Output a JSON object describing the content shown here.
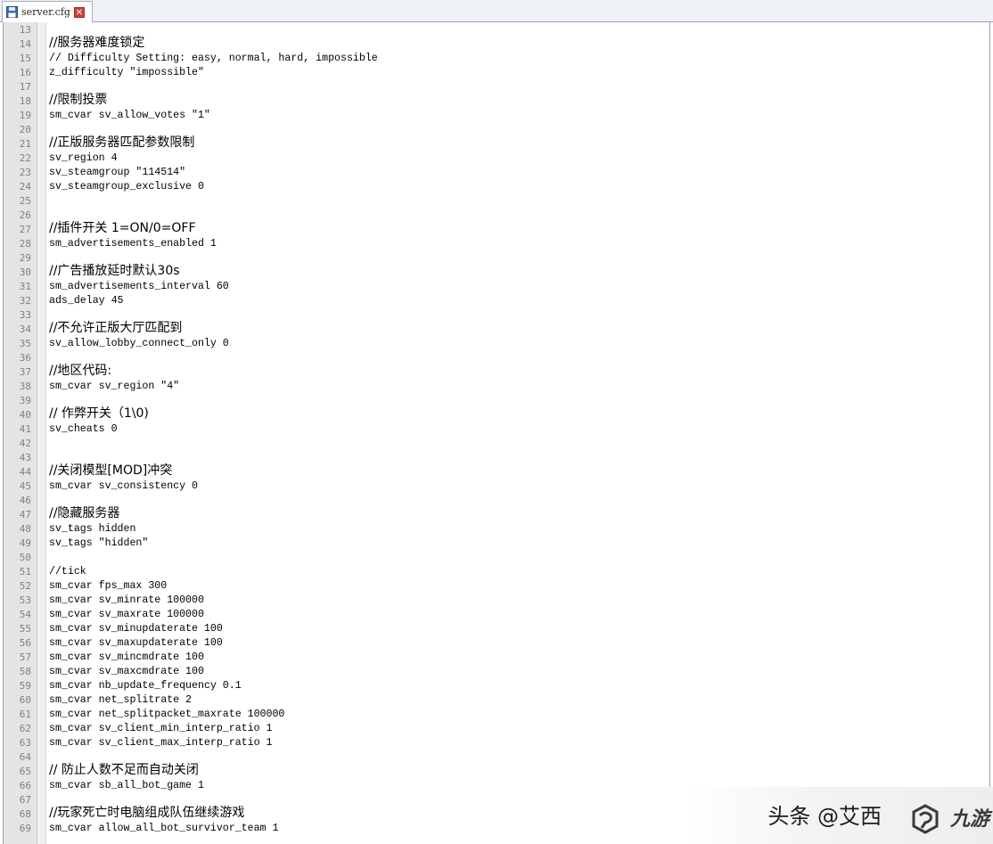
{
  "tab": {
    "title": "server.cfg",
    "close_glyph": "✕"
  },
  "editor": {
    "lines": [
      {
        "n": "13",
        "text": "",
        "zh": false
      },
      {
        "n": "14",
        "text": "//服务器难度锁定",
        "zh": true
      },
      {
        "n": "15",
        "text": "// Difficulty Setting: easy, normal, hard, impossible",
        "zh": false
      },
      {
        "n": "16",
        "text": "z_difficulty \"impossible\"",
        "zh": false
      },
      {
        "n": "17",
        "text": "",
        "zh": false
      },
      {
        "n": "18",
        "text": "//限制投票",
        "zh": true
      },
      {
        "n": "19",
        "text": "sm_cvar sv_allow_votes \"1\"",
        "zh": false
      },
      {
        "n": "20",
        "text": "",
        "zh": false
      },
      {
        "n": "21",
        "text": "//正版服务器匹配参数限制",
        "zh": true
      },
      {
        "n": "22",
        "text": "sv_region 4",
        "zh": false
      },
      {
        "n": "23",
        "text": "sv_steamgroup \"114514\"",
        "zh": false
      },
      {
        "n": "24",
        "text": "sv_steamgroup_exclusive 0",
        "zh": false
      },
      {
        "n": "25",
        "text": "",
        "zh": false
      },
      {
        "n": "26",
        "text": "",
        "zh": false
      },
      {
        "n": "27",
        "text": "//插件开关 1=ON/0=OFF",
        "zh": true
      },
      {
        "n": "28",
        "text": "sm_advertisements_enabled 1",
        "zh": false
      },
      {
        "n": "29",
        "text": "",
        "zh": false
      },
      {
        "n": "30",
        "text": "//广告播放延时默认30s",
        "zh": true
      },
      {
        "n": "31",
        "text": "sm_advertisements_interval 60",
        "zh": false
      },
      {
        "n": "32",
        "text": "ads_delay 45",
        "zh": false
      },
      {
        "n": "33",
        "text": "",
        "zh": false
      },
      {
        "n": "34",
        "text": "//不允许正版大厅匹配到",
        "zh": true
      },
      {
        "n": "35",
        "text": "sv_allow_lobby_connect_only 0",
        "zh": false
      },
      {
        "n": "36",
        "text": "",
        "zh": false
      },
      {
        "n": "37",
        "text": "//地区代码:",
        "zh": true
      },
      {
        "n": "38",
        "text": "sm_cvar sv_region \"4\"",
        "zh": false
      },
      {
        "n": "39",
        "text": "",
        "zh": false
      },
      {
        "n": "40",
        "text": "// 作弊开关（1\\0)",
        "zh": true
      },
      {
        "n": "41",
        "text": "sv_cheats 0",
        "zh": false
      },
      {
        "n": "42",
        "text": "",
        "zh": false
      },
      {
        "n": "43",
        "text": "",
        "zh": false
      },
      {
        "n": "44",
        "text": "//关闭模型[MOD]冲突",
        "zh": true
      },
      {
        "n": "45",
        "text": "sm_cvar sv_consistency 0",
        "zh": false
      },
      {
        "n": "46",
        "text": "",
        "zh": false
      },
      {
        "n": "47",
        "text": "//隐藏服务器",
        "zh": true
      },
      {
        "n": "48",
        "text": "sv_tags hidden",
        "zh": false
      },
      {
        "n": "49",
        "text": "sv_tags \"hidden\"",
        "zh": false
      },
      {
        "n": "50",
        "text": "",
        "zh": false
      },
      {
        "n": "51",
        "text": "//tick",
        "zh": false
      },
      {
        "n": "52",
        "text": "sm_cvar fps_max 300",
        "zh": false
      },
      {
        "n": "53",
        "text": "sm_cvar sv_minrate 100000",
        "zh": false
      },
      {
        "n": "54",
        "text": "sm_cvar sv_maxrate 100000",
        "zh": false
      },
      {
        "n": "55",
        "text": "sm_cvar sv_minupdaterate 100",
        "zh": false
      },
      {
        "n": "56",
        "text": "sm_cvar sv_maxupdaterate 100",
        "zh": false
      },
      {
        "n": "57",
        "text": "sm_cvar sv_mincmdrate 100",
        "zh": false
      },
      {
        "n": "58",
        "text": "sm_cvar sv_maxcmdrate 100",
        "zh": false
      },
      {
        "n": "59",
        "text": "sm_cvar nb_update_frequency 0.1",
        "zh": false
      },
      {
        "n": "60",
        "text": "sm_cvar net_splitrate 2",
        "zh": false
      },
      {
        "n": "61",
        "text": "sm_cvar net_splitpacket_maxrate 100000",
        "zh": false
      },
      {
        "n": "62",
        "text": "sm_cvar sv_client_min_interp_ratio 1",
        "zh": false
      },
      {
        "n": "63",
        "text": "sm_cvar sv_client_max_interp_ratio 1",
        "zh": false
      },
      {
        "n": "64",
        "text": "",
        "zh": false
      },
      {
        "n": "65",
        "text": "// 防止人数不足而自动关闭",
        "zh": true
      },
      {
        "n": "66",
        "text": "sm_cvar sb_all_bot_game 1",
        "zh": false
      },
      {
        "n": "67",
        "text": "",
        "zh": false
      },
      {
        "n": "68",
        "text": "//玩家死亡时电脑组成队伍继续游戏",
        "zh": true
      },
      {
        "n": "69",
        "text": "sm_cvar allow_all_bot_survivor_team 1",
        "zh": false
      }
    ]
  },
  "watermark": {
    "text": "头条 @艾西",
    "logo_text": "九游"
  }
}
